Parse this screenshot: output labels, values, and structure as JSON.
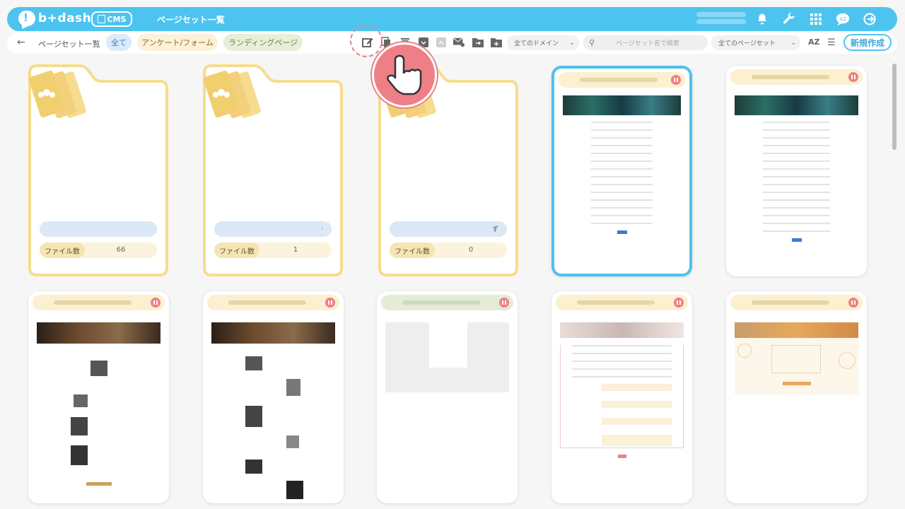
{
  "app": {
    "logo_text": "b+dash",
    "cms_label": "CMS",
    "page_title": "ページセット一覧"
  },
  "header_icons": [
    "bell-icon",
    "wrench-icon",
    "grid-icon",
    "chat-icon",
    "logout-icon"
  ],
  "subbar": {
    "breadcrumb": "ページセット一覧",
    "tabs": {
      "all": "全て",
      "survey": "アンケート/フォーム",
      "landing": "ランディングページ"
    },
    "domain_select": "全てのドメイン",
    "search_placeholder": "ページセット名で検索",
    "pageset_select": "全てのページセット",
    "sort_label": "AZ",
    "new_button": "新規作成"
  },
  "toolbar_icons": [
    "edit-icon",
    "copy-icon",
    "delete-icon",
    "archive-icon",
    "unarchive-icon",
    "mail-icon",
    "move-folder-icon",
    "add-folder-icon"
  ],
  "folders": [
    {
      "file_count_label": "ファイル数",
      "file_count": "66",
      "name_suffix": ""
    },
    {
      "file_count_label": "ファイル数",
      "file_count": "1",
      "name_suffix": "."
    },
    {
      "file_count_label": "ファイル数",
      "file_count": "0",
      "name_suffix": "ず"
    }
  ],
  "colors": {
    "accent": "#4dc4ef",
    "folder_border": "#f6dc8e",
    "pause_badge": "#ee7f86"
  }
}
